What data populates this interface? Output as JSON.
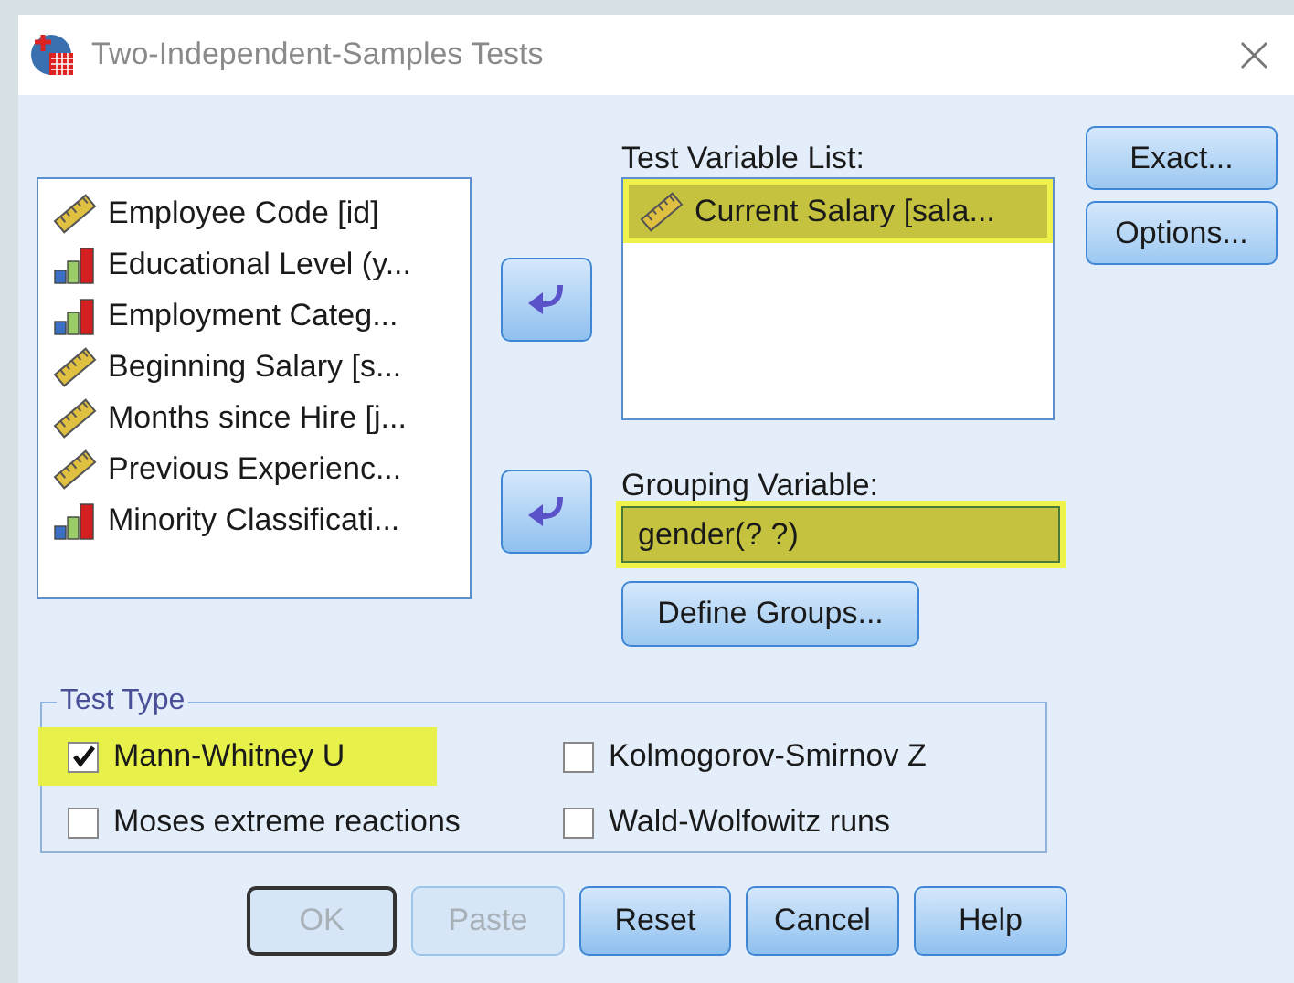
{
  "window": {
    "title": "Two-Independent-Samples Tests",
    "close": "×"
  },
  "source_variables": [
    {
      "label": "Employee Code [id]",
      "kind": "scale"
    },
    {
      "label": "Educational Level (y...",
      "kind": "ordinal"
    },
    {
      "label": "Employment Categ...",
      "kind": "ordinal"
    },
    {
      "label": "Beginning Salary [s...",
      "kind": "scale"
    },
    {
      "label": "Months since Hire [j...",
      "kind": "scale"
    },
    {
      "label": "Previous Experienc...",
      "kind": "scale"
    },
    {
      "label": "Minority Classificati...",
      "kind": "ordinal"
    }
  ],
  "test_variable_list": {
    "label": "Test Variable List:",
    "items": [
      {
        "label": "Current Salary [sala...",
        "kind": "scale",
        "highlighted": true
      }
    ]
  },
  "grouping_variable": {
    "label": "Grouping Variable:",
    "value": "gender(? ?)",
    "highlighted": true
  },
  "define_groups_button": "Define Groups...",
  "side_buttons": [
    "Exact...",
    "Options..."
  ],
  "test_type": {
    "label": "Test Type",
    "options": [
      {
        "label": "Mann-Whitney U",
        "checked": true,
        "highlighted": true
      },
      {
        "label": "Kolmogorov-Smirnov Z",
        "checked": false,
        "highlighted": false
      },
      {
        "label": "Moses extreme reactions",
        "checked": false,
        "highlighted": false
      },
      {
        "label": "Wald-Wolfowitz runs",
        "checked": false,
        "highlighted": false
      }
    ]
  },
  "buttons": [
    {
      "label": "OK",
      "disabled": true,
      "focused": true
    },
    {
      "label": "Paste",
      "disabled": true,
      "focused": false
    },
    {
      "label": "Reset",
      "disabled": false,
      "focused": false
    },
    {
      "label": "Cancel",
      "disabled": false,
      "focused": false
    },
    {
      "label": "Help",
      "disabled": false,
      "focused": false
    }
  ]
}
